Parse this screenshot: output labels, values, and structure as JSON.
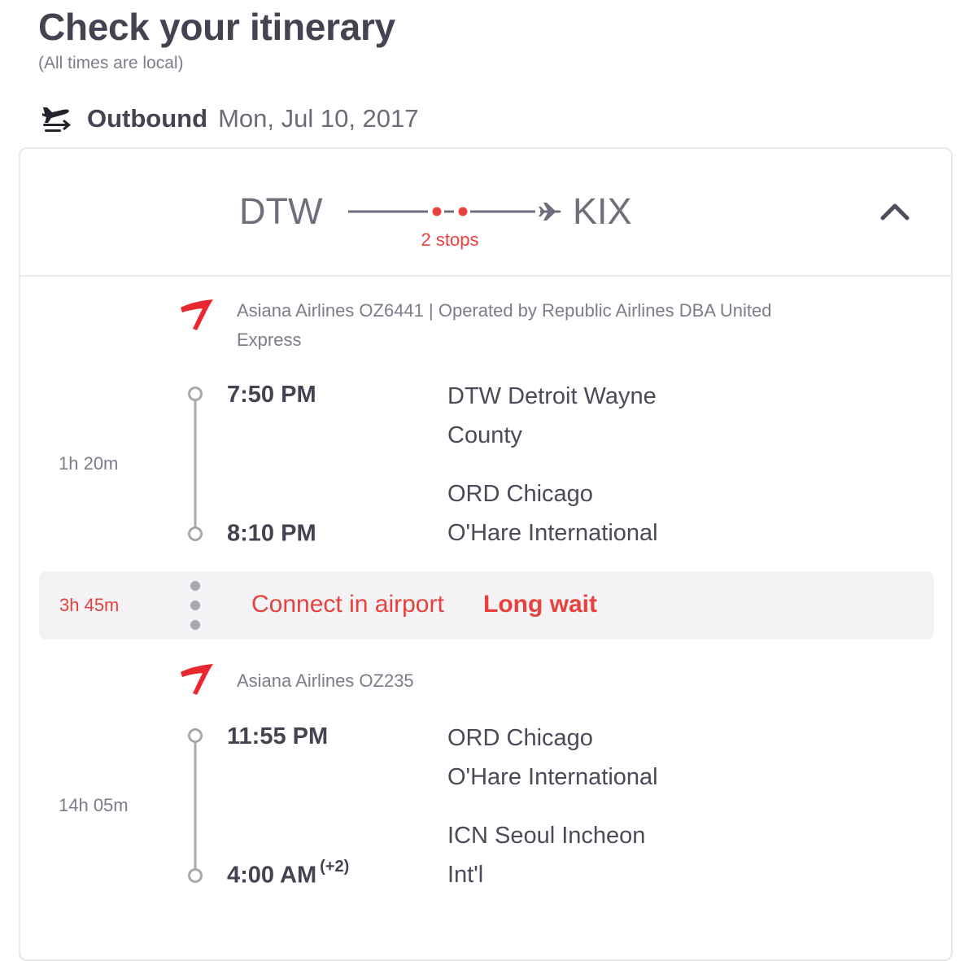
{
  "header": {
    "title": "Check your itinerary",
    "subtitle": "(All times are local)"
  },
  "outbound": {
    "icon": "departing-plane-icon",
    "label": "Outbound",
    "date": "Mon, Jul 10, 2017"
  },
  "route": {
    "origin": "DTW",
    "destination": "KIX",
    "stops": "2 stops",
    "stops_color": "#e8413d",
    "collapse_icon": "chevron-up-icon"
  },
  "segments": [
    {
      "airline_logo": "asiana-airlines-logo",
      "airline_line1": "Asiana Airlines OZ6441 | Operated by Republic Airlines DBA United",
      "airline_line2": "Express",
      "duration": "1h 20m",
      "depart_time": "7:50 PM",
      "depart_airport_line1": "DTW Detroit Wayne",
      "depart_airport_line2": "County",
      "arrive_time": "8:10 PM",
      "arrive_day_offset": "",
      "arrive_airport_line1": "ORD Chicago",
      "arrive_airport_line2": "O'Hare International"
    },
    {
      "airline_logo": "asiana-airlines-logo",
      "airline_line1": "Asiana Airlines OZ235",
      "airline_line2": "",
      "duration": "14h 05m",
      "depart_time": "11:55 PM",
      "depart_airport_line1": "ORD Chicago",
      "depart_airport_line2": "O'Hare International",
      "arrive_time": "4:00 AM",
      "arrive_day_offset": "(+2)",
      "arrive_airport_line1": "ICN Seoul Incheon",
      "arrive_airport_line2": "Int'l"
    }
  ],
  "layover": {
    "duration": "3h 45m",
    "message": "Connect in airport",
    "warning": "Long wait",
    "color": "#e8413d"
  },
  "colors": {
    "accent_red": "#e8413d",
    "text_dark": "#434352",
    "text_muted": "#7d7d8a",
    "timeline_gray": "#a9a9b3",
    "layover_bg": "#f3f3f6"
  }
}
